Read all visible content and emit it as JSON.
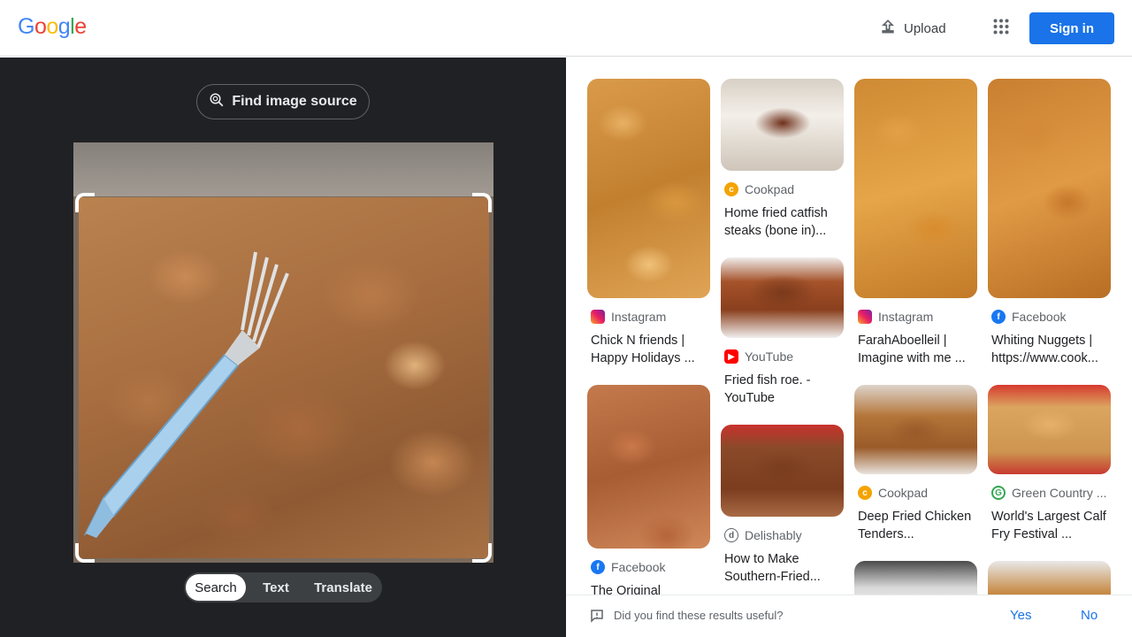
{
  "header": {
    "logo": [
      "G",
      "o",
      "o",
      "g",
      "l",
      "e"
    ],
    "logo_colors": [
      "#4285f4",
      "#ea4335",
      "#fbbc05",
      "#4285f4",
      "#34a853",
      "#ea4335"
    ],
    "upload_label": "Upload",
    "signin_label": "Sign in"
  },
  "left": {
    "find_source_label": "Find image source",
    "modes": {
      "search": "Search",
      "text": "Text",
      "translate": "Translate",
      "active": "Search"
    }
  },
  "results": {
    "col1": [
      {
        "source": "Instagram",
        "icon": "instagram-icon",
        "title": "Chick N friends | Happy Holidays ..."
      },
      {
        "source": "Facebook",
        "icon": "facebook-icon",
        "title": "The Original"
      }
    ],
    "col2": [
      {
        "source": "Cookpad",
        "icon": "cookpad-icon",
        "title": "Home fried catfish steaks (bone in)..."
      },
      {
        "source": "YouTube",
        "icon": "youtube-icon",
        "title": "Fried fish roe. - YouTube"
      },
      {
        "source": "Delishably",
        "icon": "delishably-icon",
        "title": "How to Make Southern-Fried..."
      }
    ],
    "col3": [
      {
        "source": "Instagram",
        "icon": "instagram-icon",
        "title": "FarahAboelleil | Imagine with me ..."
      },
      {
        "source": "Cookpad",
        "icon": "cookpad-icon",
        "title": "Deep Fried Chicken Tenders..."
      }
    ],
    "col4": [
      {
        "source": "Facebook",
        "icon": "facebook-icon",
        "title": "Whiting Nuggets | https://www.cook..."
      },
      {
        "source": "Green Country ...",
        "icon": "green-country-icon",
        "title": "World's Largest Calf Fry Festival ..."
      }
    ]
  },
  "feedback": {
    "question": "Did you find these results useful?",
    "yes": "Yes",
    "no": "No"
  },
  "colors": {
    "accent": "#1a73e8",
    "dark_panel": "#202124"
  }
}
